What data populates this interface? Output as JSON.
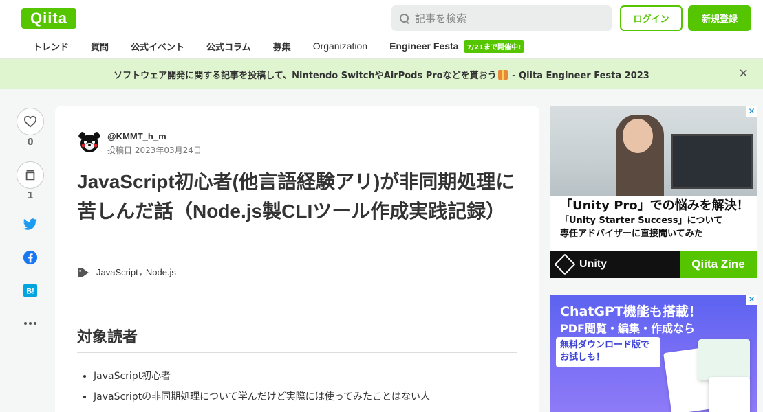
{
  "header": {
    "logo": "Qiita",
    "search_placeholder": "記事を検索",
    "login": "ログイン",
    "signup": "新規登録"
  },
  "nav": {
    "items": [
      "トレンド",
      "質問",
      "公式イベント",
      "公式コラム",
      "募集",
      "Organization",
      "Engineer Festa"
    ],
    "badge": "7/21まで開催中!"
  },
  "banner": {
    "text_before": "ソフトウェア開発に関する記事を投稿して、Nintendo SwitchやAirPods Proなどを貰おう",
    "text_after": " - Qiita Engineer Festa 2023"
  },
  "side": {
    "like_count": "0",
    "stock_count": "1"
  },
  "article": {
    "author": "@KMMT_h_m",
    "date": "投稿日 2023年03月24日",
    "title": "JavaScript初心者(他言語経験アリ)が非同期処理に苦しんだ話（Node.js製CLIツール作成実践記録）",
    "tags": [
      "JavaScript",
      "Node.js"
    ],
    "section_title": "対象読者",
    "list": [
      "JavaScript初心者",
      "JavaScriptの非同期処理について学んだけど実際には使ってみたことはない人"
    ]
  },
  "ads": {
    "ad1": {
      "line1": "「Unity Pro」での悩みを解決！",
      "line2": "「Unity Starter Success」について",
      "line3": "専任アドバイザーに直接聞いてみた",
      "brand_left": "Unity",
      "brand_right": "Qiita Zine"
    },
    "ad2": {
      "line1": "ChatGPT機能も搭載！",
      "line2": "PDF閲覧・編集・作成ならPDFelement",
      "badge_line1": "無料ダウンロード版で",
      "badge_line2": "お試しも！"
    }
  },
  "colors": {
    "brand": "#55c500",
    "banner_bg": "#dff5cf"
  }
}
